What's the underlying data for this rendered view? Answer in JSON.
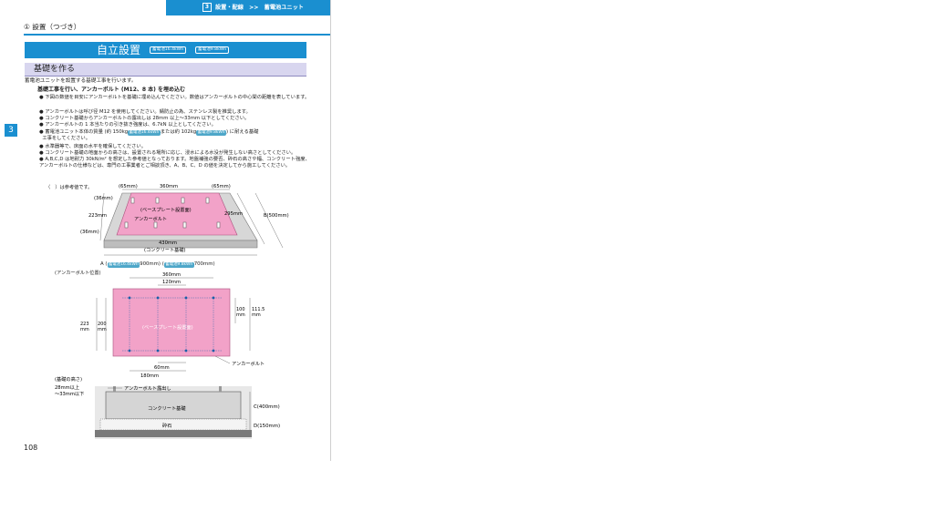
{
  "header": {
    "chapter_no": "3",
    "breadcrumb": "設置・配線　>>　蓄電池ユニット"
  },
  "section_title": "① 設置（つづき）",
  "banner": {
    "title": "自立設置",
    "tag1": "蓄電池16.4kWh",
    "tag2": "蓄電池9.8kWh"
  },
  "subhead": "基礎を作る",
  "intro": "蓄電池ユニットを設置する基礎工事を行います。",
  "step_title": "基礎工事を行い、アンカーボルト (M12、8 本) を埋め込む",
  "bullets": [
    "下図の数値を目安にアンカーボルトを基礎に埋め込んでください。数値はアンカーボルトの中心間の距離を表しています。",
    "アンカーボルトは呼び径 M12 を使用してください。錆防止の為、ステンレス製を推奨します。",
    "コンクリート基礎からアンカーボルトの露出しは 28mm 以上～33mm 以下としてください。",
    "アンカーボルトの 1 本当たりの引き抜き強度は、6.7kN 以上としてください。",
    "水準器等で、床面の水平を確保してください。",
    "コンクリート基礎の地面からの高さは、設置される場所に応じ、浸水による水没が発生しない高さとしてください。",
    "A,B,C,D は地耐力 30kN/m² を想定した参考値となっております。地盤補強の要否、砕石の高さや幅、コンクリート強度、アンカーボルトの仕様などは、専門の工事業者とご相談頂き、A、B、C、D の値を決定してから施工してください。"
  ],
  "weight_line": {
    "pre": "蓄電池ユニット本体の質量 (約 150kg",
    "tag1": "蓄電池16.4kWh",
    "mid": "または約 102kg",
    "tag2": "蓄電池9.8kWh",
    "post": ") に耐える基礎",
    "cont": "工事をしてください。"
  },
  "ref_note": "（　）は参考値です。",
  "fig1": {
    "top_65_l": "(65mm)",
    "top_360": "360mm",
    "top_65_r": "(65mm)",
    "l_36_top": "(36mm)",
    "l_223": "223mm",
    "l_36_bot": "(36mm)",
    "r_295": "295mm",
    "b_500": "B(500mm)",
    "base_plate": "(ベースプレート設置面)",
    "anchor": "アンカーボルト",
    "w_430": "430mm",
    "concrete": "(コンクリート基礎)",
    "a_pre": "A (",
    "a_tag1": "蓄電池16.4kWh",
    "a_mid": "900mm) (",
    "a_tag2": "蓄電池9.8kWh",
    "a_post": "700mm)"
  },
  "fig2": {
    "title": "(アンカーボルト位置)",
    "d360": "360mm",
    "d120": "120mm",
    "l223": "223",
    "l223u": "mm",
    "l200": "200",
    "l200u": "mm",
    "r100": "100",
    "r100u": "mm",
    "r111": "111.5",
    "r111u": "mm",
    "center": "(ベースプレート設置面)",
    "anchor": "アンカーボルト",
    "d60": "60mm",
    "d180": "180mm"
  },
  "fig3": {
    "title": "(基礎の高さ)",
    "exp1": "28mm以上",
    "exp2": "～33mm以下",
    "anchor_exp": "アンカーボルト露出し",
    "concrete": "コンクリート基礎",
    "gravel": "砕石",
    "c": "C(400mm)",
    "d": "D(150mm)"
  },
  "page_number": "108",
  "colors": {
    "brand_blue": "#1a8fd0",
    "pink": "#f2a2c8",
    "tag_blue": "#4ea7c9",
    "subhead_bg": "#d8d6ef"
  }
}
